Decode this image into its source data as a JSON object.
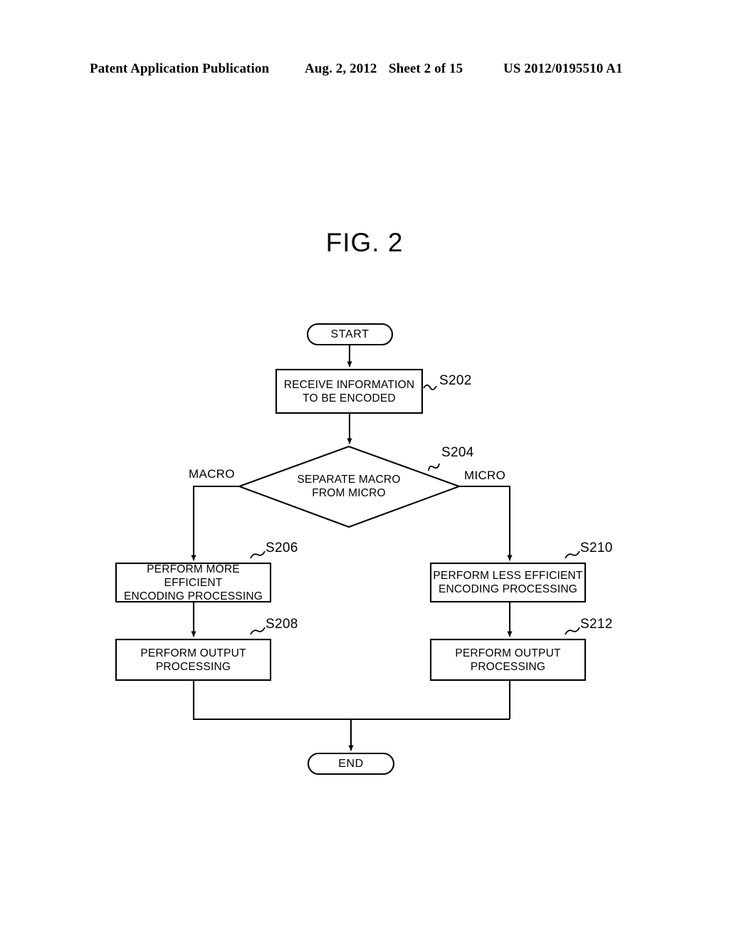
{
  "header": {
    "publication": "Patent Application Publication",
    "date": "Aug. 2, 2012",
    "sheet": "Sheet 2 of 15",
    "document_number": "US 2012/0195510 A1"
  },
  "figure": {
    "title": "FIG. 2"
  },
  "flowchart": {
    "start_label": "START",
    "end_label": "END",
    "nodes": [
      {
        "id": "s202",
        "text": "RECEIVE INFORMATION\nTO BE ENCODED",
        "step": "S202",
        "shape": "process"
      },
      {
        "id": "s204",
        "text": "SEPARATE MACRO\nFROM MICRO",
        "step": "S204",
        "shape": "decision"
      },
      {
        "id": "s206",
        "text": "PERFORM MORE EFFICIENT\nENCODING PROCESSING",
        "step": "S206",
        "shape": "process"
      },
      {
        "id": "s208",
        "text": "PERFORM OUTPUT\nPROCESSING",
        "step": "S208",
        "shape": "process"
      },
      {
        "id": "s210",
        "text": "PERFORM LESS EFFICIENT\nENCODING PROCESSING",
        "step": "S210",
        "shape": "process"
      },
      {
        "id": "s212",
        "text": "PERFORM OUTPUT\nPROCESSING",
        "step": "S212",
        "shape": "process"
      }
    ],
    "branches": [
      {
        "id": "macro",
        "label": "MACRO"
      },
      {
        "id": "micro",
        "label": "MICRO"
      }
    ]
  },
  "colors": {
    "ink": "#000000",
    "paper": "#ffffff"
  }
}
